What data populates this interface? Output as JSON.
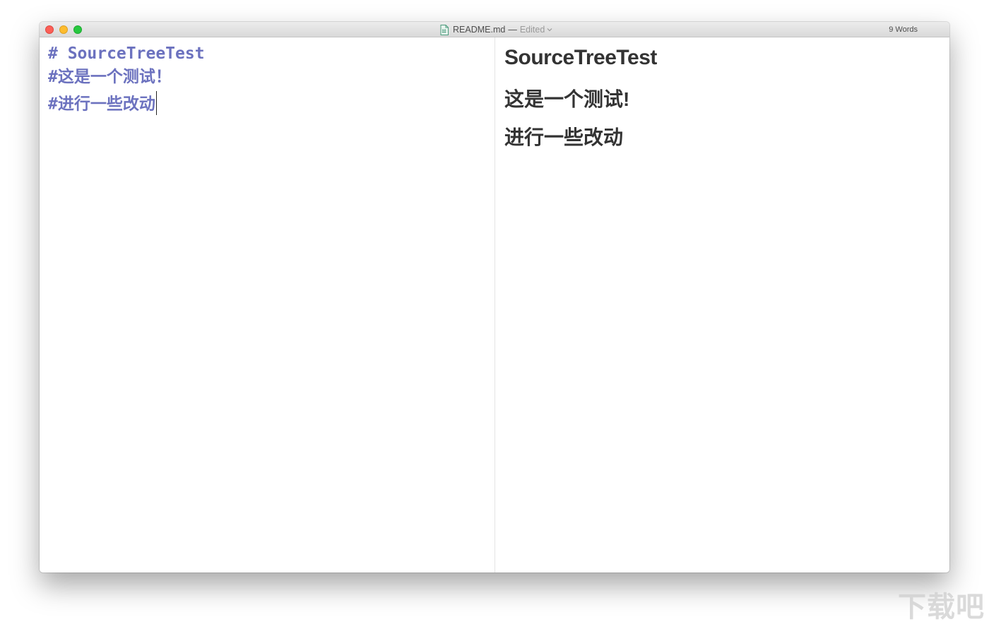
{
  "window": {
    "filename": "README.md",
    "separator": "—",
    "status": "Edited",
    "word_count": "9 Words"
  },
  "editor": {
    "lines": [
      "# SourceTreeTest",
      "#这是一个测试！",
      "#进行一些改动"
    ]
  },
  "preview": {
    "headings": [
      "SourceTreeTest",
      "这是一个测试!",
      "进行一些改动"
    ]
  },
  "watermark": "下载吧",
  "colors": {
    "markdown_syntax": "#6c72bf",
    "preview_text": "#333333",
    "close": "#fc5f57",
    "minimize": "#fdbc2e",
    "zoom": "#28c840"
  },
  "icons": {
    "document": "markdown-document-icon",
    "status_menu": "chevron-down-icon"
  }
}
